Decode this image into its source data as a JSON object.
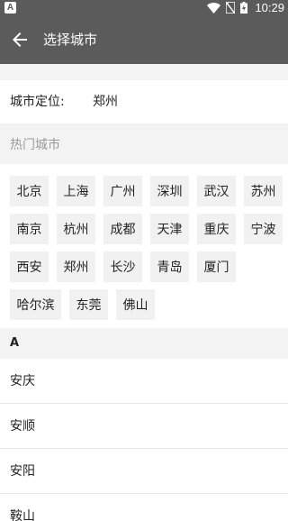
{
  "status_bar": {
    "app_icon_letter": "A",
    "time": "10:29"
  },
  "app_bar": {
    "back_icon": "arrow-left-icon",
    "title": "选择城市"
  },
  "location": {
    "label": "城市定位:",
    "value": "郑州"
  },
  "hot_cities": {
    "title": "热门城市",
    "rows": [
      [
        "北京",
        "上海",
        "广州",
        "深圳",
        "武汉",
        "苏州"
      ],
      [
        "南京",
        "杭州",
        "成都",
        "天津",
        "重庆",
        "宁波"
      ],
      [
        "西安",
        "郑州",
        "长沙",
        "青岛",
        "厦门"
      ],
      [
        "哈尔滨",
        "东莞",
        "佛山"
      ]
    ]
  },
  "section": {
    "letter": "A"
  },
  "city_list": [
    "安庆",
    "安顺",
    "安阳",
    "鞍山"
  ],
  "colors": {
    "app_bar": "#5b5b5b",
    "background_band": "#f3f3f3",
    "chip": "#f1f1f1"
  }
}
